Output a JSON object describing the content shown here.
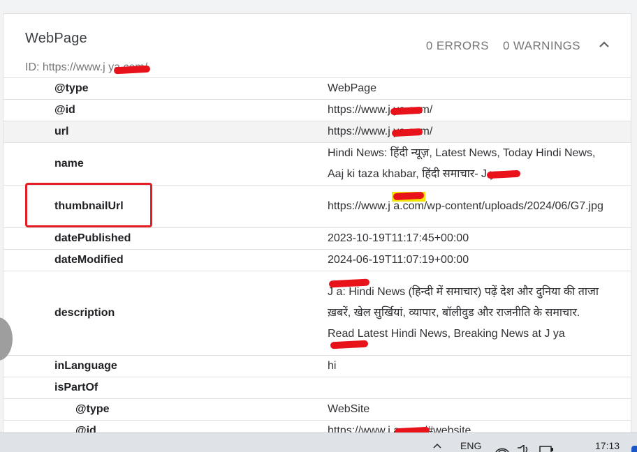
{
  "card": {
    "title": "WebPage",
    "id_line": "ID: https://www.j        ya.com/",
    "errors": "0 ERRORS",
    "warnings": "0 WARNINGS"
  },
  "rows": [
    {
      "key": "@type",
      "value": "WebPage"
    },
    {
      "key": "@id",
      "value": "https://www.j        ya.com/"
    },
    {
      "key": "url",
      "value": "https://www.j        ya.com/"
    },
    {
      "key": "name",
      "value": "Hindi News: हिंदी न्यूज़, Latest News, Today Hindi News, Aaj ki taza khabar, हिंदी समाचार- J        ya"
    },
    {
      "key": "thumbnailUrl",
      "value": "https://www.j        a.com/wp-content/uploads/2024/06/G7.jpg"
    },
    {
      "key": "datePublished",
      "value": "2023-10-19T11:17:45+00:00"
    },
    {
      "key": "dateModified",
      "value": "2024-06-19T11:07:19+00:00"
    },
    {
      "key": "description",
      "value": "J        a: Hindi News (हिन्दी में समाचार) पढ़ें देश और दुनिया की ताजा ख़बरें, खेल सुर्खियां, व्यापार, बॉलीवुड और राजनीति के समाचार. Read Latest Hindi News, Breaking News at J        ya"
    },
    {
      "key": "inLanguage",
      "value": "hi"
    },
    {
      "key": "isPartOf",
      "value": ""
    },
    {
      "key": "@type",
      "value": "WebSite"
    },
    {
      "key": "@id",
      "value": "https://www.j        a.com/#website"
    }
  ],
  "taskbar": {
    "language": "ENG",
    "time": "17:13",
    "icons": [
      "chevron-up-icon",
      "wifi-icon",
      "volume-icon",
      "battery-icon"
    ]
  },
  "colors": {
    "annotation_red": "#e31e24",
    "redaction_red": "#e8121b",
    "highlight_yellow": "#f2e600"
  }
}
